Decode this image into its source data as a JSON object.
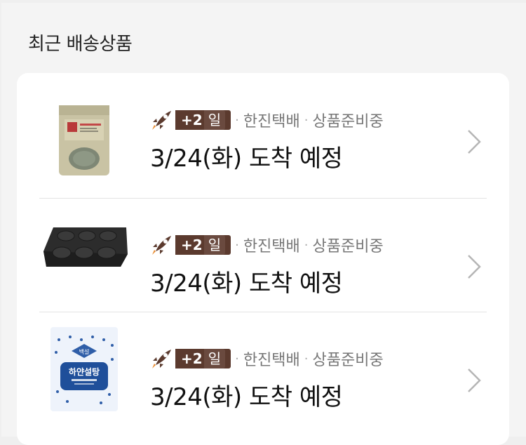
{
  "section_title": "최근 배송상품",
  "items": [
    {
      "product_icon": "powder-pouch-icon",
      "rocket_icon": "rocket-icon",
      "badge_plus": "+2",
      "badge_unit": "일",
      "carrier": "한진택배",
      "status": "상품준비중",
      "eta": "3/24(화) 도착 예정"
    },
    {
      "product_icon": "madeleine-baking-tray-icon",
      "rocket_icon": "rocket-icon",
      "badge_plus": "+2",
      "badge_unit": "일",
      "carrier": "한진택배",
      "status": "상품준비중",
      "eta": "3/24(화) 도착 예정"
    },
    {
      "product_icon": "sugar-bag-icon",
      "rocket_icon": "rocket-icon",
      "badge_plus": "+2",
      "badge_unit": "일",
      "carrier": "한진택배",
      "status": "상품준비중",
      "eta": "3/24(화) 도착 예정",
      "product_print": {
        "brand_seal": "백설",
        "name": "하얀설탕"
      }
    }
  ],
  "colors": {
    "badge_bg": "#5b3a2e",
    "meta_text": "#777777",
    "chevron": "#b5b5b5"
  }
}
